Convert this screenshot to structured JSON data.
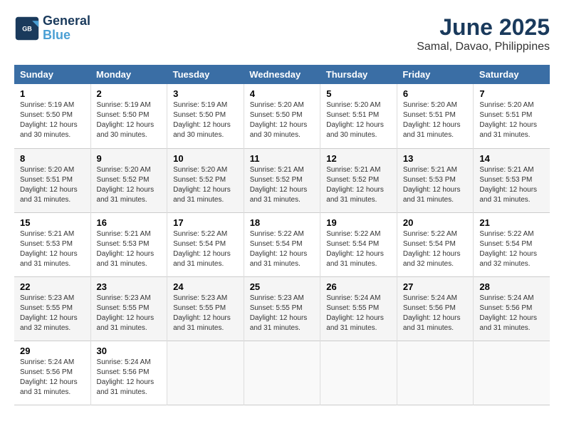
{
  "header": {
    "logo_line1": "General",
    "logo_line2": "Blue",
    "month_year": "June 2025",
    "location": "Samal, Davao, Philippines"
  },
  "days_of_week": [
    "Sunday",
    "Monday",
    "Tuesday",
    "Wednesday",
    "Thursday",
    "Friday",
    "Saturday"
  ],
  "weeks": [
    [
      {
        "day": "1",
        "sunrise": "5:19 AM",
        "sunset": "5:50 PM",
        "daylight": "12 hours and 30 minutes."
      },
      {
        "day": "2",
        "sunrise": "5:19 AM",
        "sunset": "5:50 PM",
        "daylight": "12 hours and 30 minutes."
      },
      {
        "day": "3",
        "sunrise": "5:19 AM",
        "sunset": "5:50 PM",
        "daylight": "12 hours and 30 minutes."
      },
      {
        "day": "4",
        "sunrise": "5:20 AM",
        "sunset": "5:50 PM",
        "daylight": "12 hours and 30 minutes."
      },
      {
        "day": "5",
        "sunrise": "5:20 AM",
        "sunset": "5:51 PM",
        "daylight": "12 hours and 30 minutes."
      },
      {
        "day": "6",
        "sunrise": "5:20 AM",
        "sunset": "5:51 PM",
        "daylight": "12 hours and 31 minutes."
      },
      {
        "day": "7",
        "sunrise": "5:20 AM",
        "sunset": "5:51 PM",
        "daylight": "12 hours and 31 minutes."
      }
    ],
    [
      {
        "day": "8",
        "sunrise": "5:20 AM",
        "sunset": "5:51 PM",
        "daylight": "12 hours and 31 minutes."
      },
      {
        "day": "9",
        "sunrise": "5:20 AM",
        "sunset": "5:52 PM",
        "daylight": "12 hours and 31 minutes."
      },
      {
        "day": "10",
        "sunrise": "5:20 AM",
        "sunset": "5:52 PM",
        "daylight": "12 hours and 31 minutes."
      },
      {
        "day": "11",
        "sunrise": "5:21 AM",
        "sunset": "5:52 PM",
        "daylight": "12 hours and 31 minutes."
      },
      {
        "day": "12",
        "sunrise": "5:21 AM",
        "sunset": "5:52 PM",
        "daylight": "12 hours and 31 minutes."
      },
      {
        "day": "13",
        "sunrise": "5:21 AM",
        "sunset": "5:53 PM",
        "daylight": "12 hours and 31 minutes."
      },
      {
        "day": "14",
        "sunrise": "5:21 AM",
        "sunset": "5:53 PM",
        "daylight": "12 hours and 31 minutes."
      }
    ],
    [
      {
        "day": "15",
        "sunrise": "5:21 AM",
        "sunset": "5:53 PM",
        "daylight": "12 hours and 31 minutes."
      },
      {
        "day": "16",
        "sunrise": "5:21 AM",
        "sunset": "5:53 PM",
        "daylight": "12 hours and 31 minutes."
      },
      {
        "day": "17",
        "sunrise": "5:22 AM",
        "sunset": "5:54 PM",
        "daylight": "12 hours and 31 minutes."
      },
      {
        "day": "18",
        "sunrise": "5:22 AM",
        "sunset": "5:54 PM",
        "daylight": "12 hours and 31 minutes."
      },
      {
        "day": "19",
        "sunrise": "5:22 AM",
        "sunset": "5:54 PM",
        "daylight": "12 hours and 31 minutes."
      },
      {
        "day": "20",
        "sunrise": "5:22 AM",
        "sunset": "5:54 PM",
        "daylight": "12 hours and 32 minutes."
      },
      {
        "day": "21",
        "sunrise": "5:22 AM",
        "sunset": "5:54 PM",
        "daylight": "12 hours and 32 minutes."
      }
    ],
    [
      {
        "day": "22",
        "sunrise": "5:23 AM",
        "sunset": "5:55 PM",
        "daylight": "12 hours and 32 minutes."
      },
      {
        "day": "23",
        "sunrise": "5:23 AM",
        "sunset": "5:55 PM",
        "daylight": "12 hours and 31 minutes."
      },
      {
        "day": "24",
        "sunrise": "5:23 AM",
        "sunset": "5:55 PM",
        "daylight": "12 hours and 31 minutes."
      },
      {
        "day": "25",
        "sunrise": "5:23 AM",
        "sunset": "5:55 PM",
        "daylight": "12 hours and 31 minutes."
      },
      {
        "day": "26",
        "sunrise": "5:24 AM",
        "sunset": "5:55 PM",
        "daylight": "12 hours and 31 minutes."
      },
      {
        "day": "27",
        "sunrise": "5:24 AM",
        "sunset": "5:56 PM",
        "daylight": "12 hours and 31 minutes."
      },
      {
        "day": "28",
        "sunrise": "5:24 AM",
        "sunset": "5:56 PM",
        "daylight": "12 hours and 31 minutes."
      }
    ],
    [
      {
        "day": "29",
        "sunrise": "5:24 AM",
        "sunset": "5:56 PM",
        "daylight": "12 hours and 31 minutes."
      },
      {
        "day": "30",
        "sunrise": "5:24 AM",
        "sunset": "5:56 PM",
        "daylight": "12 hours and 31 minutes."
      },
      null,
      null,
      null,
      null,
      null
    ]
  ],
  "labels": {
    "sunrise": "Sunrise:",
    "sunset": "Sunset:",
    "daylight": "Daylight:"
  }
}
